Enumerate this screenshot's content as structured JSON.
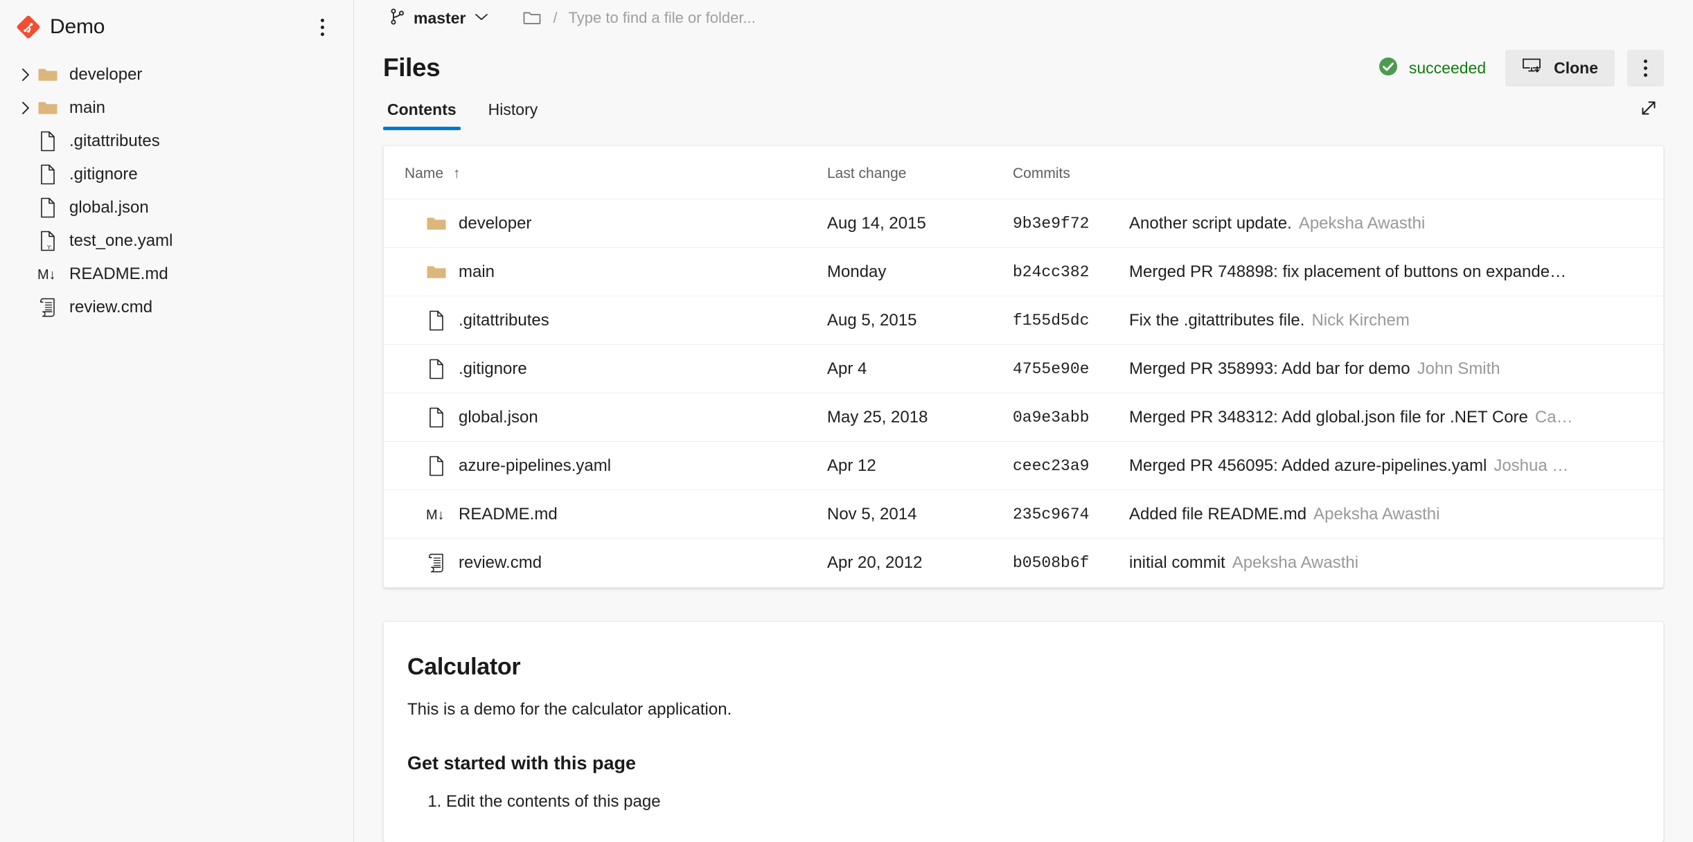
{
  "sidebar": {
    "repo_name": "Demo",
    "repo_icon": "git-repository-icon",
    "menu_icon": "more-vertical-icon",
    "items": [
      {
        "label": "developer",
        "icon": "folder-icon",
        "expandable": true
      },
      {
        "label": "main",
        "icon": "folder-icon",
        "expandable": true
      },
      {
        "label": ".gitattributes",
        "icon": "file-icon",
        "expandable": false
      },
      {
        "label": ".gitignore",
        "icon": "file-icon",
        "expandable": false
      },
      {
        "label": "global.json",
        "icon": "file-icon",
        "expandable": false
      },
      {
        "label": "test_one.yaml",
        "icon": "yaml-file-icon",
        "expandable": false
      },
      {
        "label": "README.md",
        "icon": "markdown-icon",
        "expandable": false
      },
      {
        "label": "review.cmd",
        "icon": "script-icon",
        "expandable": false
      }
    ]
  },
  "topbar": {
    "branch_icon": "git-branch-icon",
    "branch_name": "master",
    "branch_chevron": "chevron-down-icon",
    "folder_icon": "folder-outline-icon",
    "separator": "/",
    "search_placeholder": "Type to find a file or folder...",
    "search_value": ""
  },
  "header": {
    "title": "Files",
    "status_text": "succeeded",
    "status_icon": "check-circle-icon",
    "status_color": "#107c10",
    "clone_label": "Clone",
    "clone_icon": "clone-monitor-icon",
    "overflow_icon": "more-vertical-icon"
  },
  "tabs": {
    "items": [
      {
        "label": "Contents",
        "active": true
      },
      {
        "label": "History",
        "active": false
      }
    ],
    "expand_icon": "expand-diagonal-icon",
    "accent_color": "#0078d4"
  },
  "files_table": {
    "columns": [
      "Name",
      "Last change",
      "Commits",
      ""
    ],
    "sort_column": "Name",
    "sort_indicator": "↑",
    "rows": [
      {
        "name": "developer",
        "icon": "folder-icon",
        "last_change": "Aug 14, 2015",
        "commit": "9b3e9f72",
        "message": "Another script update.",
        "author": "Apeksha Awasthi"
      },
      {
        "name": "main",
        "icon": "folder-icon",
        "last_change": "Monday",
        "commit": "b24cc382",
        "message": "Merged PR 748898: fix placement of buttons on expande…",
        "author": ""
      },
      {
        "name": ".gitattributes",
        "icon": "file-icon",
        "last_change": "Aug 5, 2015",
        "commit": "f155d5dc",
        "message": "Fix the .gitattributes file.",
        "author": "Nick Kirchem"
      },
      {
        "name": ".gitignore",
        "icon": "file-icon",
        "last_change": "Apr 4",
        "commit": "4755e90e",
        "message": "Merged PR 358993: Add bar for demo",
        "author": "John Smith"
      },
      {
        "name": "global.json",
        "icon": "file-icon",
        "last_change": "May 25, 2018",
        "commit": "0a9e3abb",
        "message": "Merged PR 348312: Add global.json file for .NET Core",
        "author": "Ca…"
      },
      {
        "name": "azure-pipelines.yaml",
        "icon": "file-icon",
        "last_change": "Apr 12",
        "commit": "ceec23a9",
        "message": "Merged PR 456095: Added azure-pipelines.yaml",
        "author": "Joshua …"
      },
      {
        "name": "README.md",
        "icon": "markdown-icon",
        "last_change": "Nov 5, 2014",
        "commit": "235c9674",
        "message": "Added file README.md",
        "author": "Apeksha Awasthi"
      },
      {
        "name": "review.cmd",
        "icon": "script-icon",
        "last_change": "Apr 20, 2012",
        "commit": "b0508b6f",
        "message": "initial commit",
        "author": "Apeksha Awasthi"
      }
    ]
  },
  "readme": {
    "heading": "Calculator",
    "paragraph": "This is a demo for the calculator application.",
    "subheading": "Get started with this page",
    "list_items": [
      "Edit the contents of this page"
    ]
  }
}
